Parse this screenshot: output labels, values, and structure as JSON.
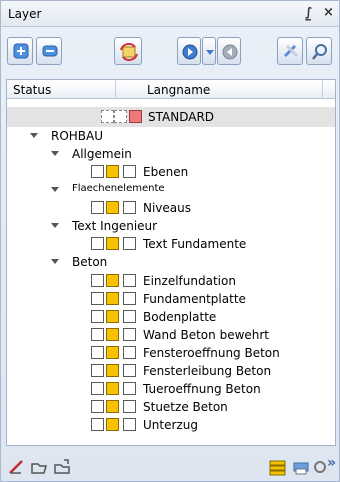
{
  "window": {
    "title": "Layer",
    "pin_glyph": "⨜",
    "close_glyph": "×"
  },
  "toolbar": {
    "buttons": [
      {
        "name": "add-layer-icon"
      },
      {
        "name": "remove-layer-icon"
      },
      {
        "name": "refresh-layer-icon"
      },
      {
        "name": "move-down-icon"
      },
      {
        "name": "dropdown-arrow-icon"
      },
      {
        "name": "move-up-icon"
      },
      {
        "name": "swap-icon"
      },
      {
        "name": "find-icon"
      }
    ]
  },
  "grid": {
    "columns": {
      "status": "Status",
      "name": "Langname"
    },
    "rows": [
      {
        "label": "STANDARD",
        "kind": "layer-standard"
      },
      {
        "label": "ROHBAU",
        "kind": "group"
      },
      {
        "label": "Allgemein",
        "kind": "subgroup"
      },
      {
        "label": "Ebenen",
        "kind": "layer"
      },
      {
        "label": "Flaechenelemente",
        "kind": "subgroup"
      },
      {
        "label": "Niveaus",
        "kind": "layer"
      },
      {
        "label": "Text Ingenieur",
        "kind": "subgroup"
      },
      {
        "label": "Text Fundamente",
        "kind": "layer"
      },
      {
        "label": "Beton",
        "kind": "subgroup"
      },
      {
        "label": "Einzelfundation",
        "kind": "layer"
      },
      {
        "label": "Fundamentplatte",
        "kind": "layer"
      },
      {
        "label": "Bodenplatte",
        "kind": "layer"
      },
      {
        "label": "Wand Beton bewehrt",
        "kind": "layer"
      },
      {
        "label": "Fensteroeffnung Beton",
        "kind": "layer"
      },
      {
        "label": "Fensterleibung Beton",
        "kind": "layer"
      },
      {
        "label": "Tueroeffnung Beton",
        "kind": "layer"
      },
      {
        "label": "Stuetze Beton",
        "kind": "layer"
      },
      {
        "label": "Unterzug",
        "kind": "layer"
      }
    ]
  },
  "bottombar": {
    "icons": [
      "pen-icon",
      "folder-open-icon",
      "folder-export-icon",
      "layers-icon",
      "print-icon",
      "settings-icon",
      "more-icon"
    ],
    "more_glyph": "»"
  },
  "colors": {
    "yellow": "#f7c200",
    "red": "#f0787a",
    "accent": "#3a7bd5"
  }
}
